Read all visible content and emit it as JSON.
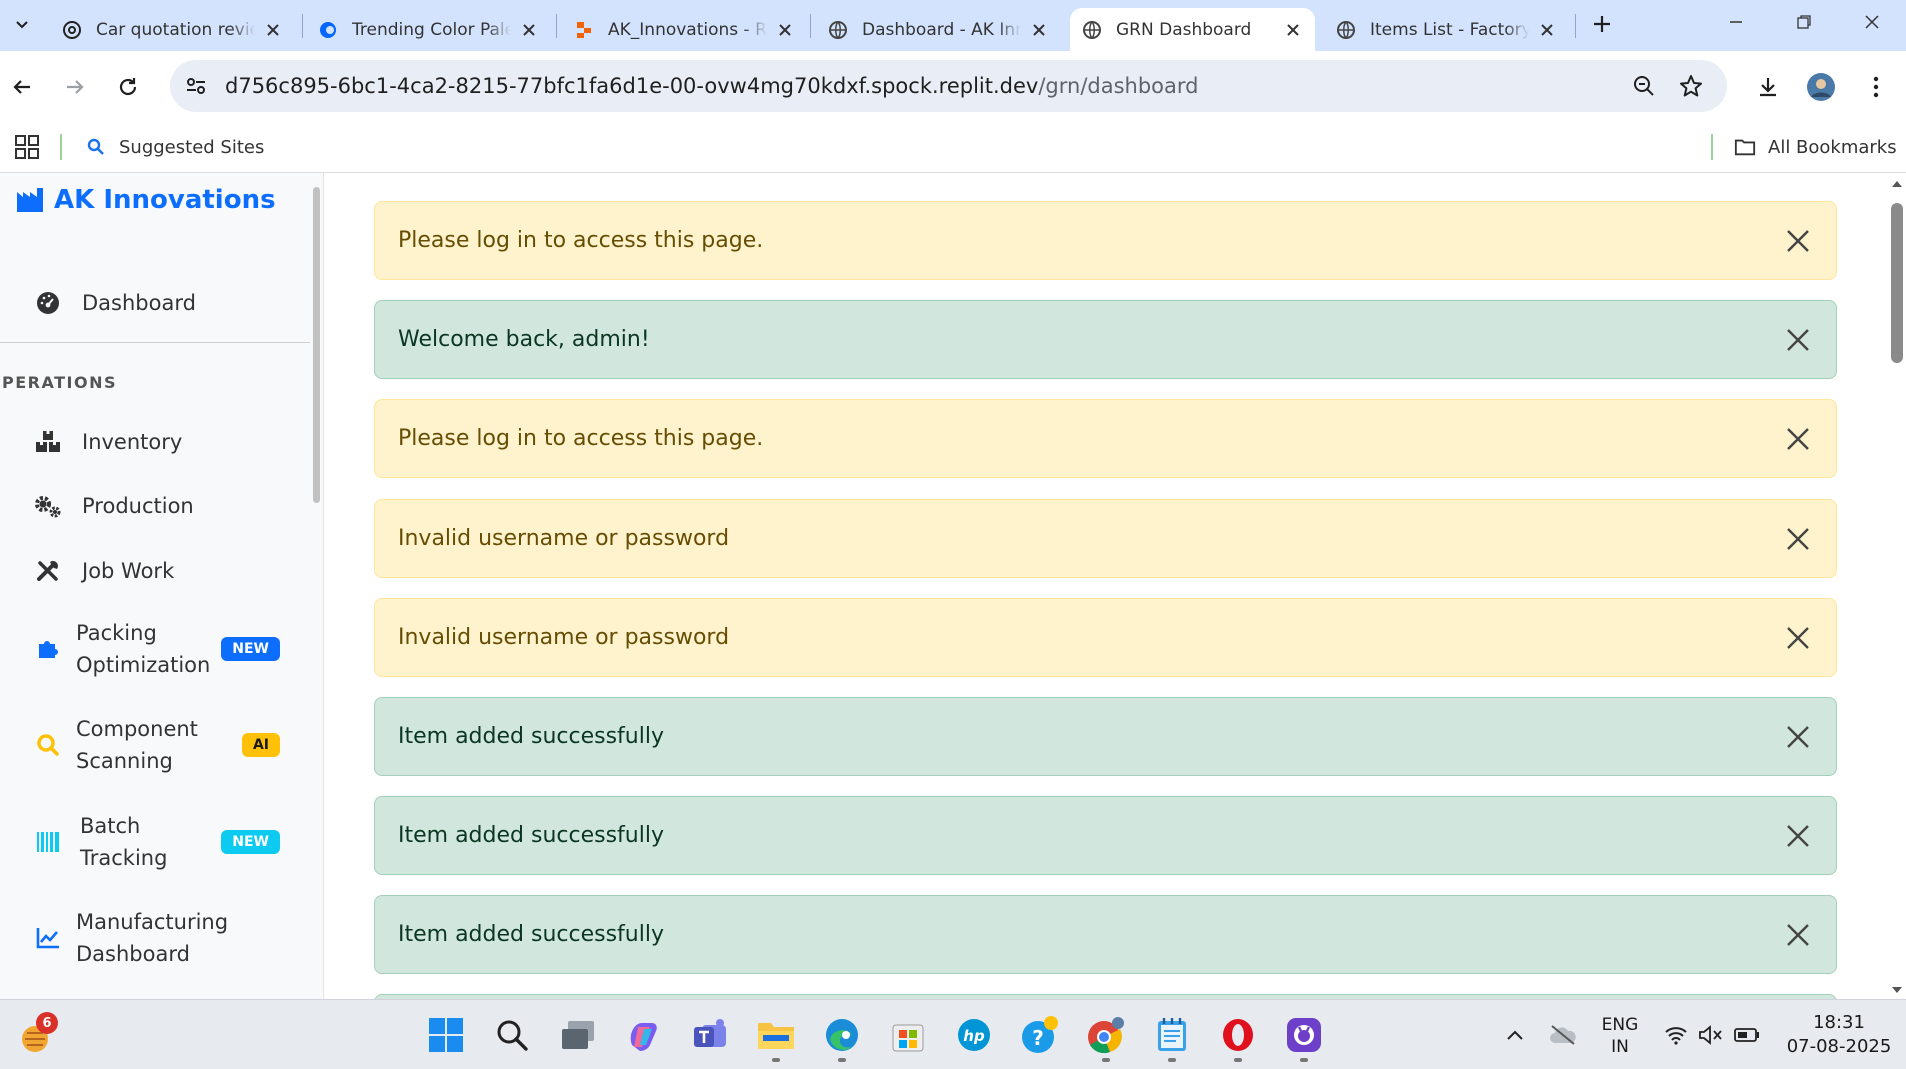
{
  "browser": {
    "tabs": [
      {
        "title": "Car quotation review",
        "active": false
      },
      {
        "title": "Trending Color Palettes",
        "active": false
      },
      {
        "title": "AK_Innovations - Replit",
        "active": false
      },
      {
        "title": "Dashboard - AK Innovations",
        "active": false
      },
      {
        "title": "GRN Dashboard",
        "active": true
      },
      {
        "title": "Items List - Factory",
        "active": false
      }
    ],
    "url_host": "d756c895-6bc1-4ca2-8215-77bfc1fa6d1e-00-ovw4mg70kdxf.spock.replit.dev",
    "url_path": "/grn/dashboard",
    "bookmarks": {
      "suggested": "Suggested Sites",
      "all": "All Bookmarks"
    }
  },
  "sidebar": {
    "brand": "AK Innovations",
    "dashboard": "Dashboard",
    "section": "PERATIONS",
    "items": [
      {
        "label": "Inventory",
        "badge": ""
      },
      {
        "label": "Production",
        "badge": ""
      },
      {
        "label": "Job Work",
        "badge": ""
      },
      {
        "label_line1": "Packing",
        "label_line2": "Optimization",
        "badge": "NEW"
      },
      {
        "label_line1": "Component",
        "label_line2": "Scanning",
        "badge": "AI"
      },
      {
        "label_line1": "Batch",
        "label_line2": "Tracking",
        "badge": "NEW"
      },
      {
        "label_line1": "Manufacturing",
        "label_line2": "Dashboard",
        "badge": ""
      }
    ]
  },
  "alerts": [
    {
      "type": "warning",
      "message": "Please log in to access this page."
    },
    {
      "type": "success",
      "message": "Welcome back, admin!"
    },
    {
      "type": "warning",
      "message": "Please log in to access this page."
    },
    {
      "type": "warning",
      "message": "Invalid username or password"
    },
    {
      "type": "warning",
      "message": "Invalid username or password"
    },
    {
      "type": "success",
      "message": "Item added successfully"
    },
    {
      "type": "success",
      "message": "Item added successfully"
    },
    {
      "type": "success",
      "message": "Item added successfully"
    }
  ],
  "taskbar": {
    "notification_count": "6",
    "lang_line1": "ENG",
    "lang_line2": "IN",
    "time": "18:31",
    "date": "07-08-2025"
  },
  "colors": {
    "brand": "#0d6efd",
    "warning_bg": "#fff3cd",
    "success_bg": "#d1e7dd",
    "badge_new_blue": "#0d6efd",
    "badge_ai": "#ffc107",
    "badge_new_cyan": "#0dcaf0"
  }
}
